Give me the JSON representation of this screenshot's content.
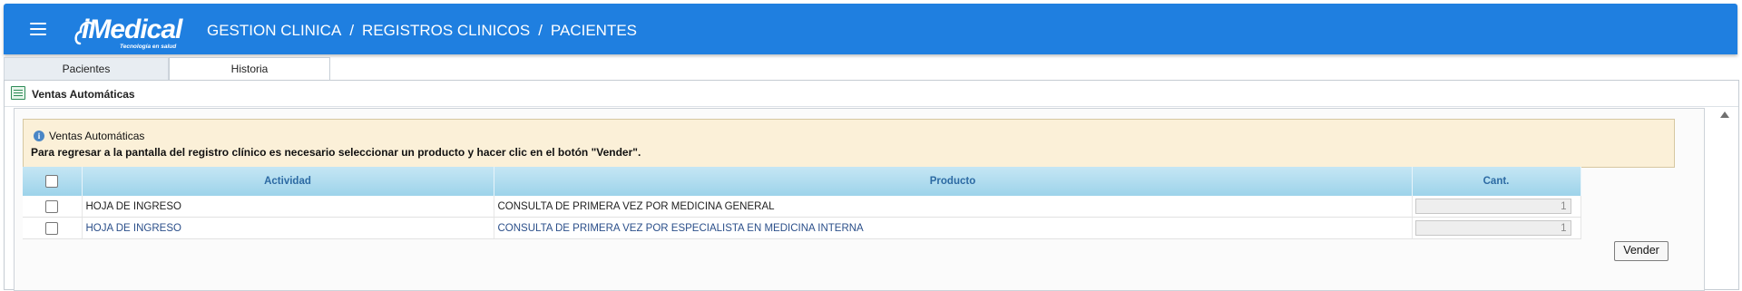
{
  "header": {
    "brand": "iMedical",
    "tagline": "Tecnología en salud",
    "breadcrumb": [
      "GESTION CLINICA",
      "REGISTROS CLINICOS",
      "PACIENTES"
    ],
    "separator": "/",
    "accent_color": "#1f7fe0"
  },
  "tabs": [
    {
      "label": "Pacientes",
      "active": false
    },
    {
      "label": "Historia",
      "active": true
    }
  ],
  "panel": {
    "title": "Ventas Automáticas",
    "icon": "list-window-icon"
  },
  "info": {
    "title": "Ventas Automáticas",
    "message": "Para regresar a la pantalla del registro clínico es necesario seleccionar un producto y hacer clic en el botón \"Vender\".",
    "icon": "info-icon"
  },
  "table": {
    "columns": [
      "Actividad",
      "Producto",
      "Cant."
    ],
    "rows": [
      {
        "actividad": "HOJA DE INGRESO",
        "producto": "CONSULTA DE PRIMERA VEZ POR MEDICINA GENERAL",
        "cant": "1"
      },
      {
        "actividad": "HOJA DE INGRESO",
        "producto": "CONSULTA DE PRIMERA VEZ POR ESPECIALISTA EN MEDICINA INTERNA",
        "cant": "1"
      }
    ]
  },
  "actions": {
    "vender": "Vender"
  }
}
